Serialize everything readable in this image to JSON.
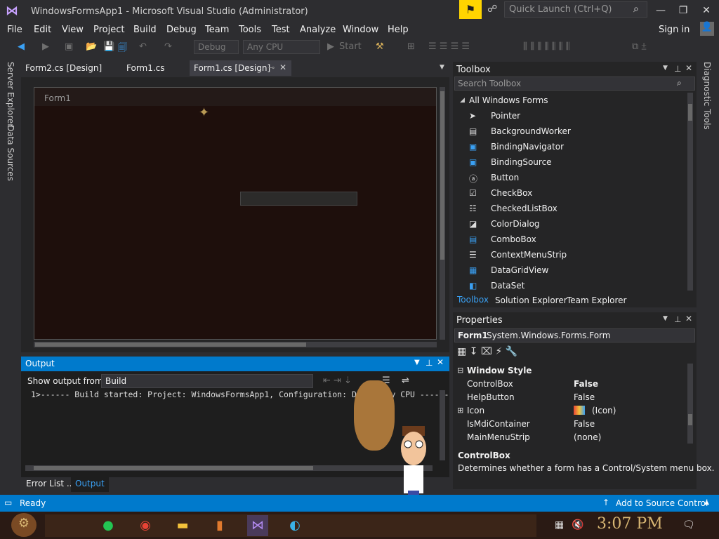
{
  "window": {
    "title": "WindowsFormsApp1 - Microsoft Visual Studio  (Administrator)",
    "quick_launch": "Quick Launch (Ctrl+Q)",
    "sign_in": "Sign in"
  },
  "menus": [
    "File",
    "Edit",
    "View",
    "Project",
    "Build",
    "Debug",
    "Team",
    "Tools",
    "Test",
    "Analyze",
    "Window",
    "Help"
  ],
  "toolbar": {
    "config": "Debug",
    "platform": "Any CPU",
    "start": "Start"
  },
  "left_tabs": [
    "Server Explorer",
    "Data Sources"
  ],
  "doc_tabs": [
    "Form2.cs [Design]",
    "Form1.cs",
    "Form1.cs [Design]"
  ],
  "designer": {
    "form_caption": "Form1",
    "button_text": ""
  },
  "output": {
    "title": "Output",
    "show_from_label": "Show output from:",
    "source": "Build",
    "text": "1>------ Build started: Project: WindowsFormsApp1, Configuration: Debug Any CPU ------"
  },
  "bottom_tabs": [
    "Error List ...",
    "Output"
  ],
  "status": {
    "left": "Ready",
    "right": "Add to Source Control"
  },
  "toolbox": {
    "title": "Toolbox",
    "search": "Search Toolbox",
    "group": "All Windows Forms",
    "items": [
      "Pointer",
      "BackgroundWorker",
      "BindingNavigator",
      "BindingSource",
      "Button",
      "CheckBox",
      "CheckedListBox",
      "ColorDialog",
      "ComboBox",
      "ContextMenuStrip",
      "DataGridView",
      "DataSet"
    ],
    "tabs": [
      "Toolbox",
      "Solution Explorer",
      "Team Explorer"
    ]
  },
  "properties": {
    "title": "Properties",
    "object": "Form1",
    "type": "System.Windows.Forms.Form",
    "category": "Window Style",
    "rows": [
      {
        "name": "ControlBox",
        "value": "False"
      },
      {
        "name": "HelpButton",
        "value": "False"
      },
      {
        "name": "Icon",
        "value": "(Icon)"
      },
      {
        "name": "IsMdiContainer",
        "value": "False"
      },
      {
        "name": "MainMenuStrip",
        "value": "(none)"
      }
    ],
    "desc_title": "ControlBox",
    "desc_text": "Determines whether a form has a Control/System menu box."
  },
  "right_tabs": [
    "Diagnostic Tools"
  ],
  "taskbar": {
    "clock": "3:07 PM"
  },
  "colors": {
    "accent": "#007acc",
    "notify": "#ffd500",
    "bg": "#2d2d30"
  }
}
